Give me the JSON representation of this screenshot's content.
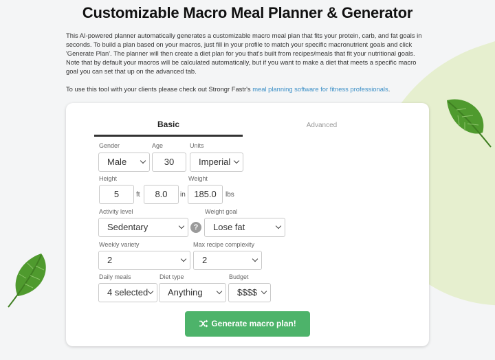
{
  "page": {
    "title": "Customizable Macro Meal Planner & Generator",
    "intro": "This AI-powered planner automatically generates a customizable macro meal plan that fits your protein, carb, and fat goals in seconds. To build a plan based on your macros, just fill in your profile to match your specific macronutrient goals and click 'Generate Plan'. The planner will then create a diet plan for you that's built from recipes/meals that fit your nutritional goals. Note that by default your macros will be calculated automatically, but if you want to make a diet that meets a specific macro goal you can set that up on the advanced tab.",
    "clients_prefix": "To use this tool with your clients please check out Strongr Fastr's ",
    "clients_link": "meal planning software for fitness professionals",
    "clients_suffix": "."
  },
  "tabs": {
    "basic": "Basic",
    "advanced": "Advanced"
  },
  "form": {
    "gender": {
      "label": "Gender",
      "value": "Male"
    },
    "age": {
      "label": "Age",
      "value": "30"
    },
    "units": {
      "label": "Units",
      "value": "Imperial"
    },
    "height": {
      "label": "Height",
      "feet": "5",
      "feet_unit": "ft",
      "inches": "8.0",
      "inches_unit": "in"
    },
    "weight": {
      "label": "Weight",
      "value": "185.0",
      "unit": "lbs"
    },
    "activity": {
      "label": "Activity level",
      "value": "Sedentary"
    },
    "help_icon": "?",
    "weight_goal": {
      "label": "Weight goal",
      "value": "Lose fat"
    },
    "variety": {
      "label": "Weekly variety",
      "value": "2"
    },
    "complexity": {
      "label": "Max recipe complexity",
      "value": "2"
    },
    "meals": {
      "label": "Daily meals",
      "value": "4 selected"
    },
    "diet": {
      "label": "Diet type",
      "value": "Anything"
    },
    "budget": {
      "label": "Budget",
      "value": "$$$$"
    }
  },
  "generate_button": "Generate macro plan!",
  "colors": {
    "accent": "#4db36a",
    "link": "#3b8fc7",
    "background": "#f4f5f6",
    "blob": "#e6efcf"
  },
  "icons": [
    "shuffle-icon",
    "question-icon",
    "spinach-leaf-icon",
    "chevron-down-icon"
  ]
}
